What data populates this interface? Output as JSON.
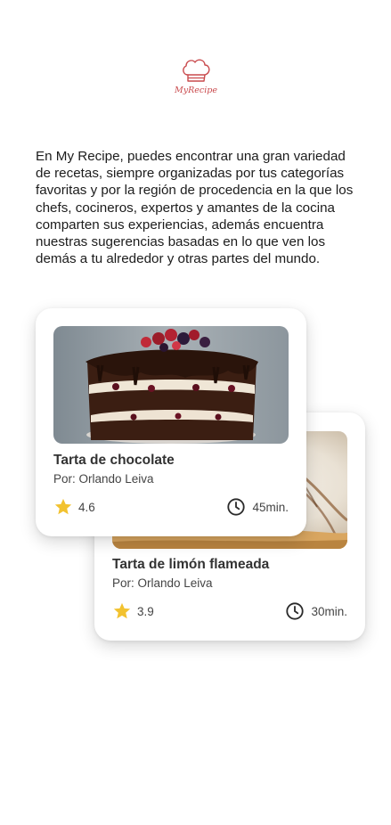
{
  "app": {
    "logo_text": "MyRecipe",
    "logo_icon": "chef-hat-icon"
  },
  "intro": {
    "text": "En My Recipe, puedes encontrar una gran variedad de recetas, siempre organizadas por tus categorías favoritas y por la región de procedencia en la que los chefs, cocineros, expertos y amantes de la cocina comparten sus experiencias, además encuentra nuestras sugerencias basadas en lo que ven los demás a tu alrededor y otras partes del mundo."
  },
  "recipes": [
    {
      "title": "Tarta de chocolate",
      "author": "Por: Orlando Leiva",
      "rating": "4.6",
      "time": "45min.",
      "image": "chocolate-cake-photo"
    },
    {
      "title": "Tarta de limón flameada",
      "author": "Por: Orlando Leiva",
      "rating": "3.9",
      "time": "30min.",
      "image": "lemon-meringue-tart-photo"
    }
  ],
  "icons": {
    "rating": "star-icon",
    "time": "clock-icon"
  },
  "colors": {
    "brand": "#c94a4d",
    "star": "#f2c230",
    "text": "#1c1c1c"
  }
}
